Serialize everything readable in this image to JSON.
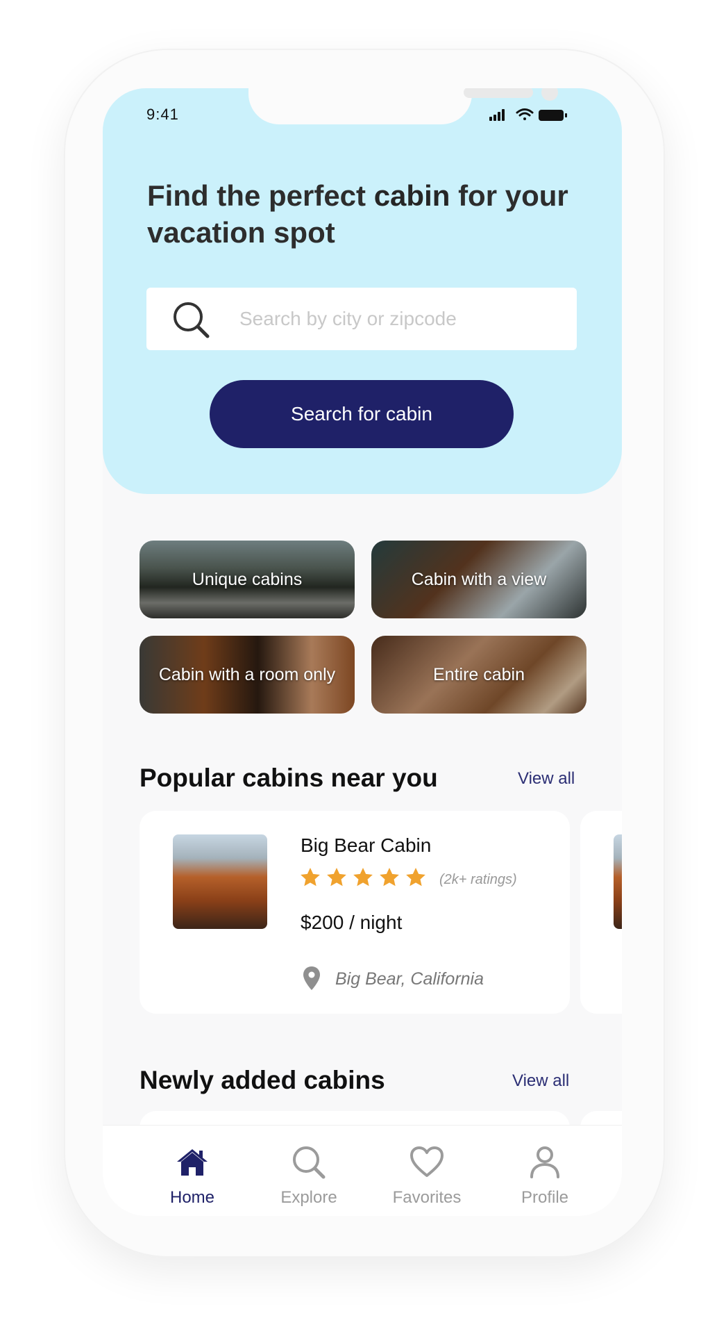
{
  "status_bar": {
    "time": "9:41"
  },
  "hero": {
    "title_part1": "Find the perfect ",
    "title_bold": "cabin",
    "title_part2": " for your vacation spot",
    "search_placeholder": "Search by city or zipcode",
    "search_button": "Search for cabin"
  },
  "categories": [
    {
      "label": "Unique cabins"
    },
    {
      "label": "Cabin with a view"
    },
    {
      "label": "Cabin with a room only"
    },
    {
      "label": "Entire cabin"
    }
  ],
  "popular": {
    "title": "Popular cabins near you",
    "view_all": "View all",
    "cards": [
      {
        "name": "Big Bear Cabin",
        "rating": 5,
        "ratings_count": "(2k+ ratings)",
        "price": "$200",
        "price_unit": " / night",
        "location": "Big Bear, California"
      }
    ]
  },
  "newly_added": {
    "title": "Newly added cabins",
    "view_all": "View all"
  },
  "tabbar": {
    "items": [
      {
        "label": "Home",
        "icon": "home-icon",
        "active": true
      },
      {
        "label": "Explore",
        "icon": "search-icon",
        "active": false
      },
      {
        "label": "Favorites",
        "icon": "heart-icon",
        "active": false
      },
      {
        "label": "Profile",
        "icon": "user-icon",
        "active": false
      }
    ]
  },
  "colors": {
    "hero_bg": "#cbf1fb",
    "primary": "#1f2168",
    "star": "#f0a22e",
    "inactive": "#9b9b9b"
  }
}
